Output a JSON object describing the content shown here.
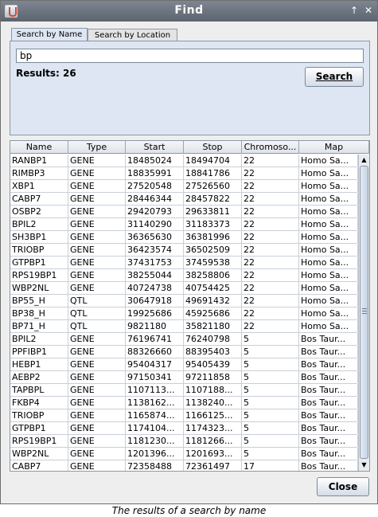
{
  "window": {
    "title": "Find"
  },
  "tabs": [
    {
      "label": "Search by Name",
      "active": true
    },
    {
      "label": "Search by Location",
      "active": false
    }
  ],
  "search": {
    "value": "bp",
    "results_label": "Results: 26",
    "button_label": "Search"
  },
  "table": {
    "columns": [
      "Name",
      "Type",
      "Start",
      "Stop",
      "Chromoso...",
      "Map"
    ],
    "rows": [
      [
        "RANBP1",
        "GENE",
        "18485024",
        "18494704",
        "22",
        "Homo Sa..."
      ],
      [
        "RIMBP3",
        "GENE",
        "18835991",
        "18841786",
        "22",
        "Homo Sa..."
      ],
      [
        "XBP1",
        "GENE",
        "27520548",
        "27526560",
        "22",
        "Homo Sa..."
      ],
      [
        "CABP7",
        "GENE",
        "28446344",
        "28457822",
        "22",
        "Homo Sa..."
      ],
      [
        "OSBP2",
        "GENE",
        "29420793",
        "29633811",
        "22",
        "Homo Sa..."
      ],
      [
        "BPIL2",
        "GENE",
        "31140290",
        "31183373",
        "22",
        "Homo Sa..."
      ],
      [
        "SH3BP1",
        "GENE",
        "36365630",
        "36381996",
        "22",
        "Homo Sa..."
      ],
      [
        "TRIOBP",
        "GENE",
        "36423574",
        "36502509",
        "22",
        "Homo Sa..."
      ],
      [
        "GTPBP1",
        "GENE",
        "37431753",
        "37459538",
        "22",
        "Homo Sa..."
      ],
      [
        "RPS19BP1",
        "GENE",
        "38255044",
        "38258806",
        "22",
        "Homo Sa..."
      ],
      [
        "WBP2NL",
        "GENE",
        "40724738",
        "40754425",
        "22",
        "Homo Sa..."
      ],
      [
        "BP55_H",
        "QTL",
        "30647918",
        "49691432",
        "22",
        "Homo Sa..."
      ],
      [
        "BP38_H",
        "QTL",
        "19925686",
        "45925686",
        "22",
        "Homo Sa..."
      ],
      [
        "BP71_H",
        "QTL",
        "9821180",
        "35821180",
        "22",
        "Homo Sa..."
      ],
      [
        "BPIL2",
        "GENE",
        "76196741",
        "76240798",
        "5",
        "Bos Taur..."
      ],
      [
        "PPFIBP1",
        "GENE",
        "88326660",
        "88395403",
        "5",
        "Bos Taur..."
      ],
      [
        "HEBP1",
        "GENE",
        "95404317",
        "95405439",
        "5",
        "Bos Taur..."
      ],
      [
        "AEBP2",
        "GENE",
        "97150341",
        "97211858",
        "5",
        "Bos Taur..."
      ],
      [
        "TAPBPL",
        "GENE",
        "1107113...",
        "1107188...",
        "5",
        "Bos Taur..."
      ],
      [
        "FKBP4",
        "GENE",
        "1138162...",
        "1138240...",
        "5",
        "Bos Taur..."
      ],
      [
        "TRIOBP",
        "GENE",
        "1165874...",
        "1166125...",
        "5",
        "Bos Taur..."
      ],
      [
        "GTPBP1",
        "GENE",
        "1174104...",
        "1174323...",
        "5",
        "Bos Taur..."
      ],
      [
        "RPS19BP1",
        "GENE",
        "1181230...",
        "1181266...",
        "5",
        "Bos Taur..."
      ],
      [
        "WBP2NL",
        "GENE",
        "1201396...",
        "1201693...",
        "5",
        "Bos Taur..."
      ],
      [
        "CABP7",
        "GENE",
        "72358488",
        "72361497",
        "17",
        "Bos Taur..."
      ]
    ]
  },
  "close_button": {
    "label": "Close"
  },
  "caption": "The results of a search by name",
  "icons": {
    "app": "java-app-icon",
    "minimize": "arrow-up-icon",
    "close": "close-icon"
  }
}
